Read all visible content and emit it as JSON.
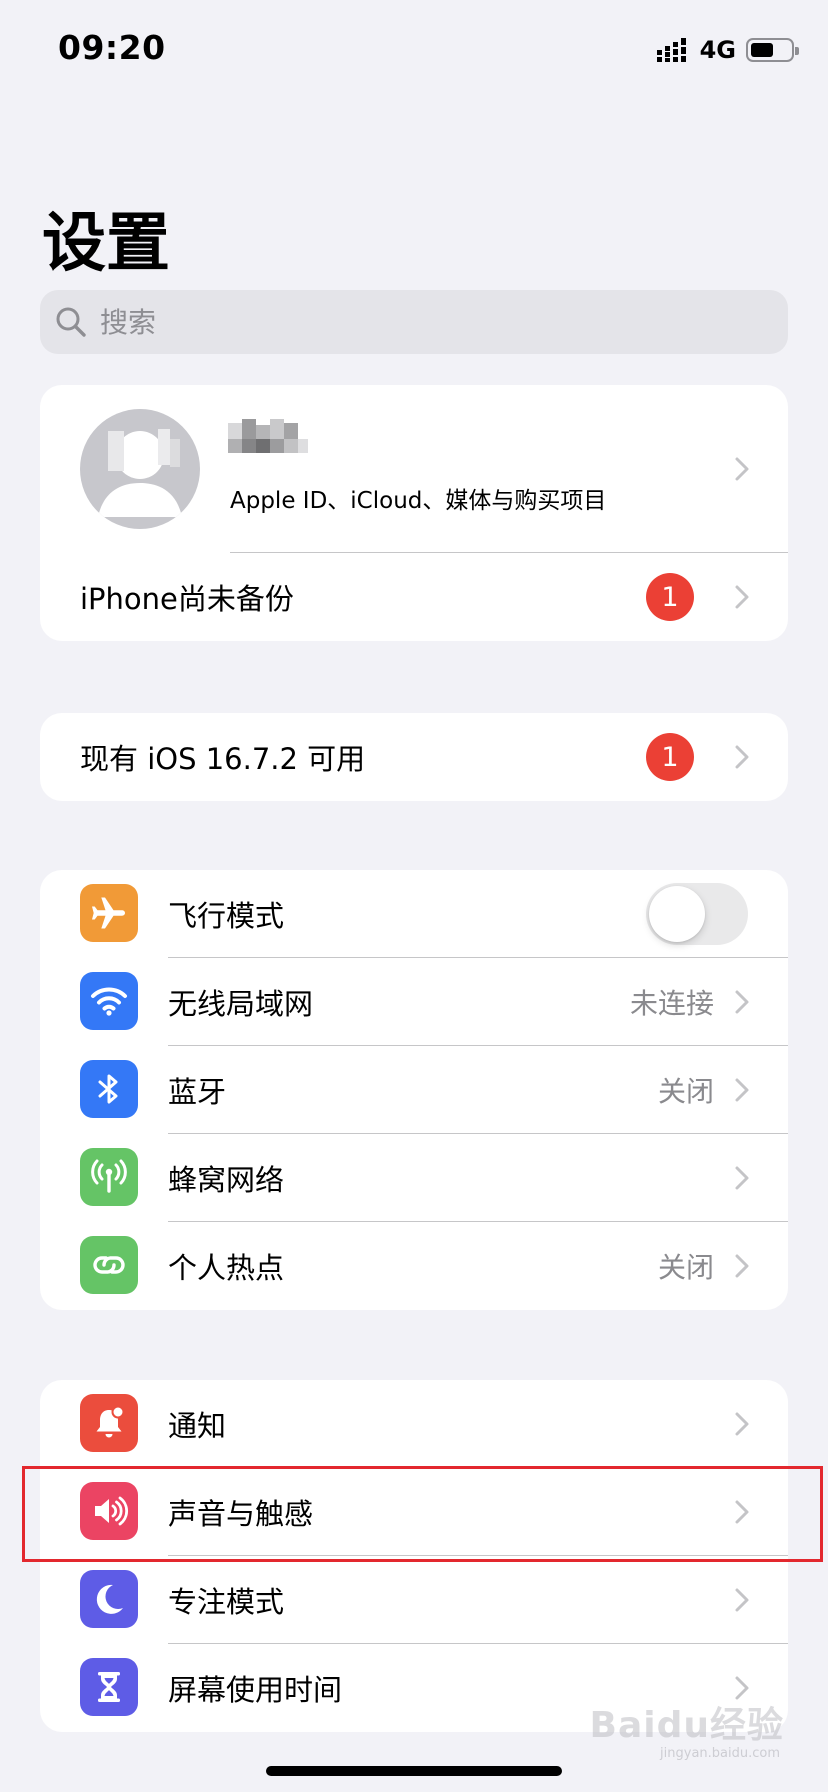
{
  "status_bar": {
    "time": "09:20",
    "network": "4G"
  },
  "page_title": "设置",
  "search": {
    "placeholder": "搜索"
  },
  "profile": {
    "subtitle": "Apple ID、iCloud、媒体与购买项目"
  },
  "backup": {
    "label": "iPhone尚未备份",
    "badge": "1"
  },
  "update": {
    "label": "现有 iOS 16.7.2 可用",
    "badge": "1"
  },
  "connectivity": {
    "items": [
      {
        "label": "飞行模式",
        "icon": "airplane-icon",
        "color": "#f19a37",
        "toggle": false
      },
      {
        "label": "无线局域网",
        "value": "未连接",
        "icon": "wifi-icon",
        "color": "#3478f6"
      },
      {
        "label": "蓝牙",
        "value": "关闭",
        "icon": "bluetooth-icon",
        "color": "#3478f6"
      },
      {
        "label": "蜂窝网络",
        "icon": "cellular-icon",
        "color": "#65c466"
      },
      {
        "label": "个人热点",
        "value": "关闭",
        "icon": "hotspot-icon",
        "color": "#65c466"
      }
    ]
  },
  "notifications_group": {
    "items": [
      {
        "label": "通知",
        "icon": "notification-bell-icon",
        "color": "#eb4d3d"
      },
      {
        "label": "声音与触感",
        "icon": "speaker-icon",
        "color": "#eb4463"
      },
      {
        "label": "专注模式",
        "icon": "moon-icon",
        "color": "#5e5ce6"
      },
      {
        "label": "屏幕使用时间",
        "icon": "hourglass-icon",
        "color": "#5e5ce6"
      }
    ]
  },
  "watermark": {
    "brand": "Baidu经验",
    "url": "jingyan.baidu.com"
  }
}
